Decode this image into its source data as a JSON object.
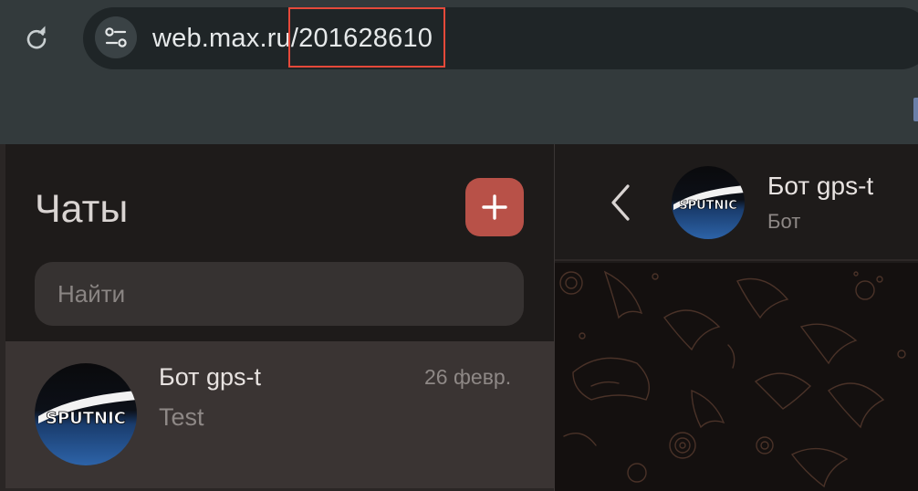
{
  "browser": {
    "url": "web.max.ru/201628610",
    "icons": {
      "reload": "reload-icon",
      "site_settings": "tune-icon"
    }
  },
  "sidebar": {
    "title": "Чаты",
    "search_placeholder": "Найти",
    "chats": [
      {
        "name": "Бот gps-t",
        "date": "26 февр.",
        "preview": "Test",
        "avatar_text": "SPUTNIC"
      }
    ]
  },
  "chat": {
    "name": "Бот gps-t",
    "subtitle": "Бот",
    "avatar_text": "SPUTNIC"
  },
  "colors": {
    "accent": "#b85148",
    "highlight_box": "#e5493a",
    "selected_row": "#3a3433"
  }
}
